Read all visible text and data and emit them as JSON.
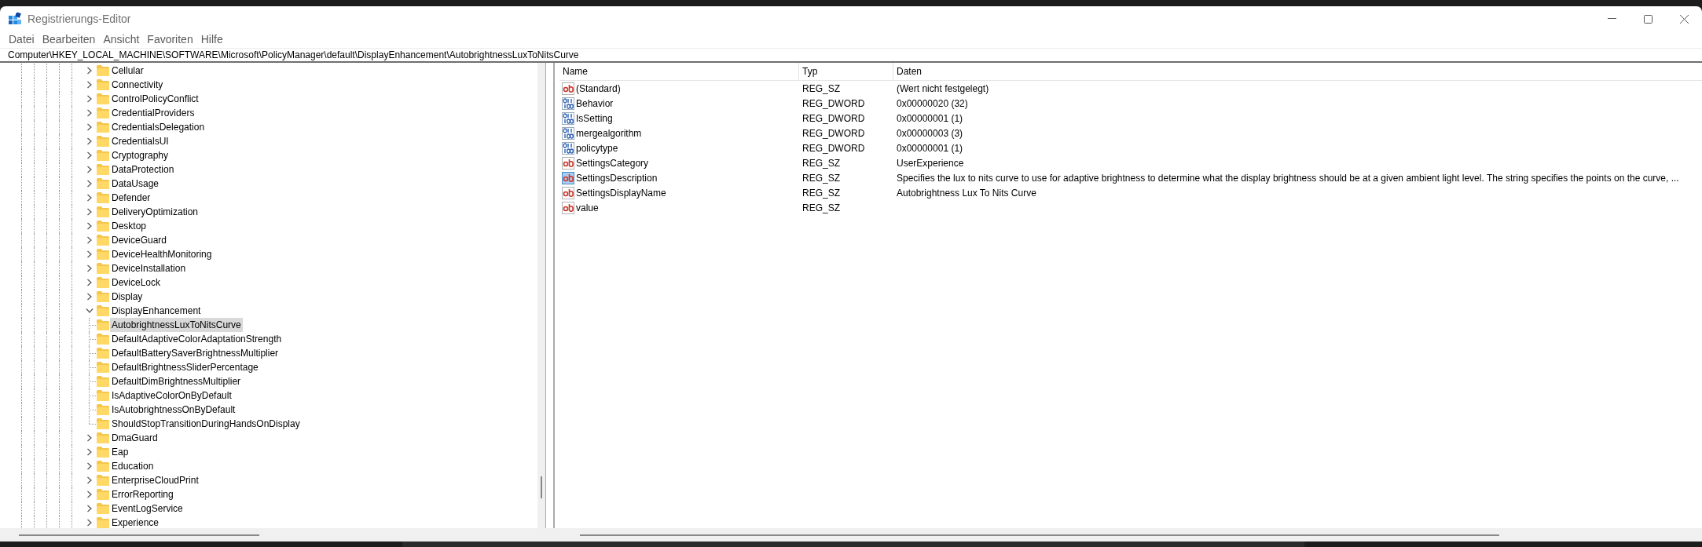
{
  "window": {
    "title": "Registrierungs-Editor"
  },
  "menu": [
    {
      "label": "Datei"
    },
    {
      "label": "Bearbeiten"
    },
    {
      "label": "Ansicht"
    },
    {
      "label": "Favoriten"
    },
    {
      "label": "Hilfe"
    }
  ],
  "address": "Computer\\HKEY_LOCAL_MACHINE\\SOFTWARE\\Microsoft\\PolicyManager\\default\\DisplayEnhancement\\AutobrightnessLuxToNitsCurve",
  "tree": {
    "items": [
      {
        "label": "Cellular",
        "expanded": false,
        "selected": false
      },
      {
        "label": "Connectivity",
        "expanded": false,
        "selected": false
      },
      {
        "label": "ControlPolicyConflict",
        "expanded": false,
        "selected": false
      },
      {
        "label": "CredentialProviders",
        "expanded": false,
        "selected": false
      },
      {
        "label": "CredentialsDelegation",
        "expanded": false,
        "selected": false
      },
      {
        "label": "CredentialsUI",
        "expanded": false,
        "selected": false
      },
      {
        "label": "Cryptography",
        "expanded": false,
        "selected": false
      },
      {
        "label": "DataProtection",
        "expanded": false,
        "selected": false
      },
      {
        "label": "DataUsage",
        "expanded": false,
        "selected": false
      },
      {
        "label": "Defender",
        "expanded": false,
        "selected": false
      },
      {
        "label": "DeliveryOptimization",
        "expanded": false,
        "selected": false
      },
      {
        "label": "Desktop",
        "expanded": false,
        "selected": false
      },
      {
        "label": "DeviceGuard",
        "expanded": false,
        "selected": false
      },
      {
        "label": "DeviceHealthMonitoring",
        "expanded": false,
        "selected": false
      },
      {
        "label": "DeviceInstallation",
        "expanded": false,
        "selected": false
      },
      {
        "label": "DeviceLock",
        "expanded": false,
        "selected": false
      },
      {
        "label": "Display",
        "expanded": false,
        "selected": false
      },
      {
        "label": "DisplayEnhancement",
        "expanded": true,
        "selected": false,
        "children": [
          {
            "label": "AutobrightnessLuxToNitsCurve",
            "selected": true
          },
          {
            "label": "DefaultAdaptiveColorAdaptationStrength",
            "selected": false
          },
          {
            "label": "DefaultBatterySaverBrightnessMultiplier",
            "selected": false
          },
          {
            "label": "DefaultBrightnessSliderPercentage",
            "selected": false
          },
          {
            "label": "DefaultDimBrightnessMultiplier",
            "selected": false
          },
          {
            "label": "IsAdaptiveColorOnByDefault",
            "selected": false
          },
          {
            "label": "IsAutobrightnessOnByDefault",
            "selected": false
          },
          {
            "label": "ShouldStopTransitionDuringHandsOnDisplay",
            "selected": false
          }
        ]
      },
      {
        "label": "DmaGuard",
        "expanded": false,
        "selected": false
      },
      {
        "label": "Eap",
        "expanded": false,
        "selected": false
      },
      {
        "label": "Education",
        "expanded": false,
        "selected": false
      },
      {
        "label": "EnterpriseCloudPrint",
        "expanded": false,
        "selected": false
      },
      {
        "label": "ErrorReporting",
        "expanded": false,
        "selected": false
      },
      {
        "label": "EventLogService",
        "expanded": false,
        "selected": false
      },
      {
        "label": "Experience",
        "expanded": false,
        "selected": false
      }
    ]
  },
  "values": {
    "columns": [
      "Name",
      "Typ",
      "Daten"
    ],
    "rows": [
      {
        "kind": "string",
        "name": "(Standard)",
        "type": "REG_SZ",
        "data": "(Wert nicht festgelegt)",
        "selected": false
      },
      {
        "kind": "dword",
        "name": "Behavior",
        "type": "REG_DWORD",
        "data": "0x00000020 (32)",
        "selected": false
      },
      {
        "kind": "dword",
        "name": "IsSetting",
        "type": "REG_DWORD",
        "data": "0x00000001 (1)",
        "selected": false
      },
      {
        "kind": "dword",
        "name": "mergealgorithm",
        "type": "REG_DWORD",
        "data": "0x00000003 (3)",
        "selected": false
      },
      {
        "kind": "dword",
        "name": "policytype",
        "type": "REG_DWORD",
        "data": "0x00000001 (1)",
        "selected": false
      },
      {
        "kind": "string",
        "name": "SettingsCategory",
        "type": "REG_SZ",
        "data": "UserExperience",
        "selected": false
      },
      {
        "kind": "string",
        "name": "SettingsDescription",
        "type": "REG_SZ",
        "data": "Specifies the lux to nits curve to use for adaptive brightness to determine what the display brightness should be at a given ambient light level. The string specifies the points on the curve, ...",
        "selected": true
      },
      {
        "kind": "string",
        "name": "SettingsDisplayName",
        "type": "REG_SZ",
        "data": "Autobrightness Lux To Nits Curve",
        "selected": false
      },
      {
        "kind": "string",
        "name": "value",
        "type": "REG_SZ",
        "selected": false
      }
    ]
  }
}
